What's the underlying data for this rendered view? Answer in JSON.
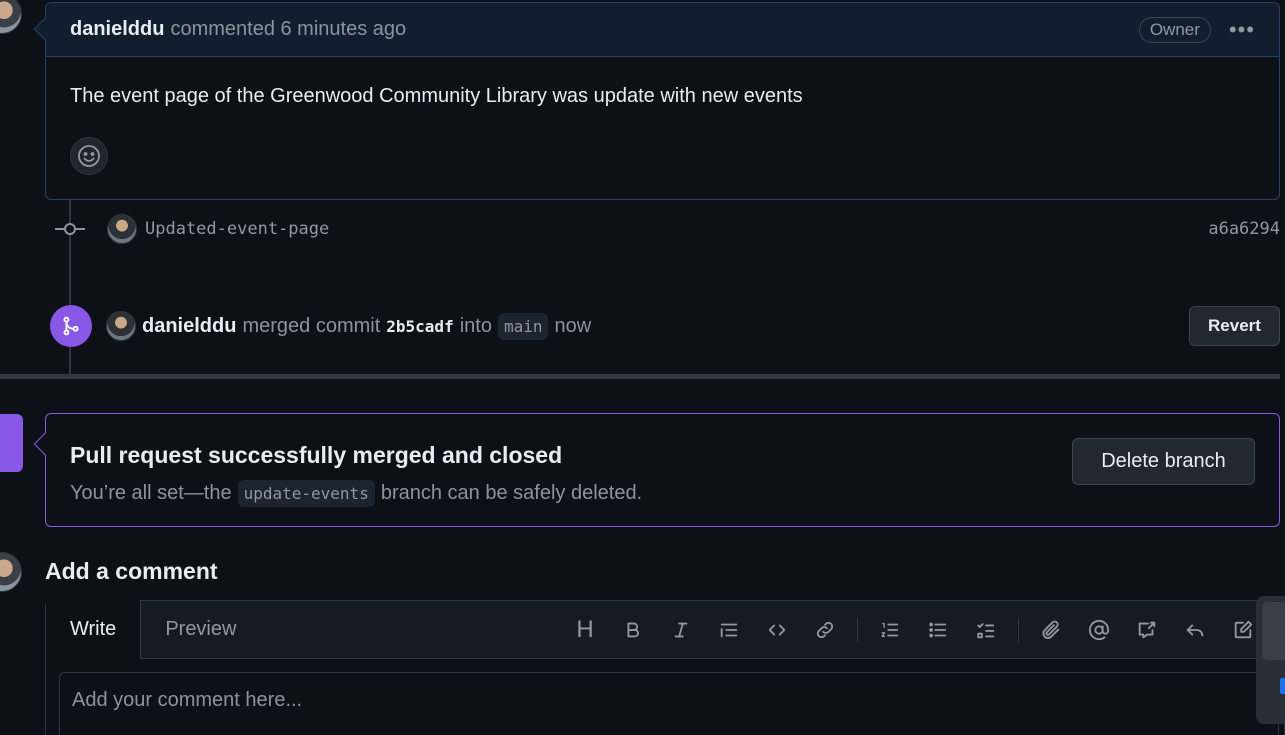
{
  "comment": {
    "author": "danielddu",
    "meta": "commented 6 minutes ago",
    "badge": "Owner",
    "menu": "•••",
    "body": "The event page of the Greenwood Community Library was update with new events"
  },
  "commit": {
    "message": "Updated-event-page",
    "sha": "a6a6294"
  },
  "merge_event": {
    "author": "danielddu",
    "action": "merged commit",
    "sha": "2b5cadf",
    "into": "into",
    "branch": "main",
    "time": "now",
    "revert_label": "Revert"
  },
  "merged_box": {
    "title": "Pull request successfully merged and closed",
    "sub_prefix": "You’re all set—the",
    "branch": "update-events",
    "sub_suffix": "branch can be safely deleted.",
    "delete_label": "Delete branch"
  },
  "add_comment": {
    "title": "Add a comment",
    "tabs": [
      "Write",
      "Preview"
    ],
    "placeholder": "Add your comment here...",
    "toolbar_heading": "H"
  },
  "colors": {
    "merged_purple": "#8957e5",
    "background": "#0d1117"
  }
}
